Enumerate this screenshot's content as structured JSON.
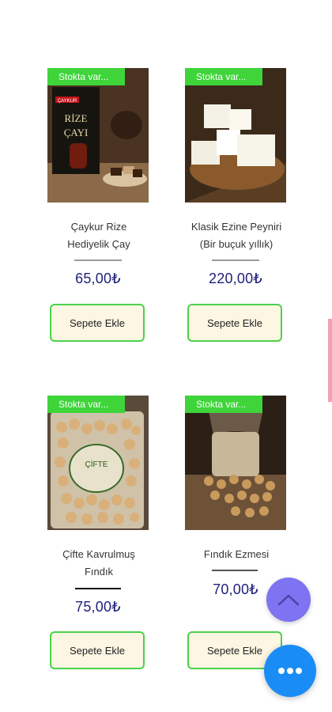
{
  "colors": {
    "badge": "#3ed43a",
    "price": "#1f1f7a",
    "button_border": "#4bd14a",
    "button_bg": "#fdf6e3",
    "scroll_top": "#7e73f0",
    "chat": "#1a8cf5"
  },
  "products": [
    {
      "badge": "Stokta var...",
      "title_line1": "Çaykur Rize",
      "title_line2": "Hediyelik Çay",
      "price": "65,00₺",
      "button": "Sepete Ekle"
    },
    {
      "badge": "Stokta var...",
      "title_line1": "Klasik Ezine Peyniri",
      "title_line2": "(Bir buçuk yıllık)",
      "price": "220,00₺",
      "button": "Sepete Ekle"
    },
    {
      "badge": "Stokta var...",
      "title_line1": "Çifte Kavrulmuş",
      "title_line2": "Fındık",
      "price": "75,00₺",
      "button": "Sepete Ekle"
    },
    {
      "badge": "Stokta var...",
      "title_line1": "Fındık Ezmesi",
      "title_line2": "",
      "price": "70,00₺",
      "button": "Sepete Ekle"
    }
  ],
  "product_images": {
    "tea_pack_line1": "ÇAYKUR",
    "tea_pack_line2": "RİZE",
    "tea_pack_line3": "ÇAYI",
    "hazelnut_bag_label": "ÇİFTE"
  },
  "icons": {
    "scroll_top": "chevron-up-icon",
    "chat": "more-dots-icon"
  }
}
